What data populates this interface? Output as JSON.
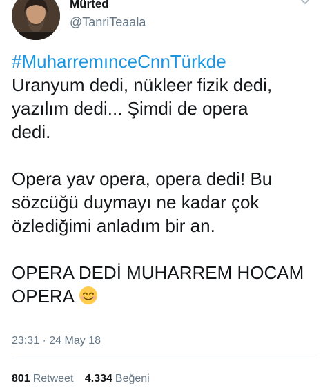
{
  "author": {
    "display_name": "Mürted",
    "handle": "@TanriTeaala"
  },
  "tweet": {
    "lines": [
      "#MuharremınceCnnTürkde",
      "Uranyum dedi, nükleer fizik dedi,",
      "yazılım dedi... Şimdi de opera",
      "dedi.",
      "",
      "Opera yav opera, opera dedi! Bu",
      "sözcüğü duymayı ne kadar çok",
      "özlediğimi anladım bir an.",
      "",
      "OPERA DEDİ MUHARREM HOCAM",
      "OPERA"
    ],
    "emoji": "smiling-face-with-smiling-eyes",
    "timestamp": "23:31 · 24 May 18"
  },
  "stats": {
    "retweets_count": "801",
    "retweets_label": "Retweet",
    "likes_count": "4.334",
    "likes_label": "Beğeni"
  },
  "colors": {
    "hashtag": "#1b95e0",
    "secondary_text": "#657786",
    "divider": "#e6ecf0"
  }
}
